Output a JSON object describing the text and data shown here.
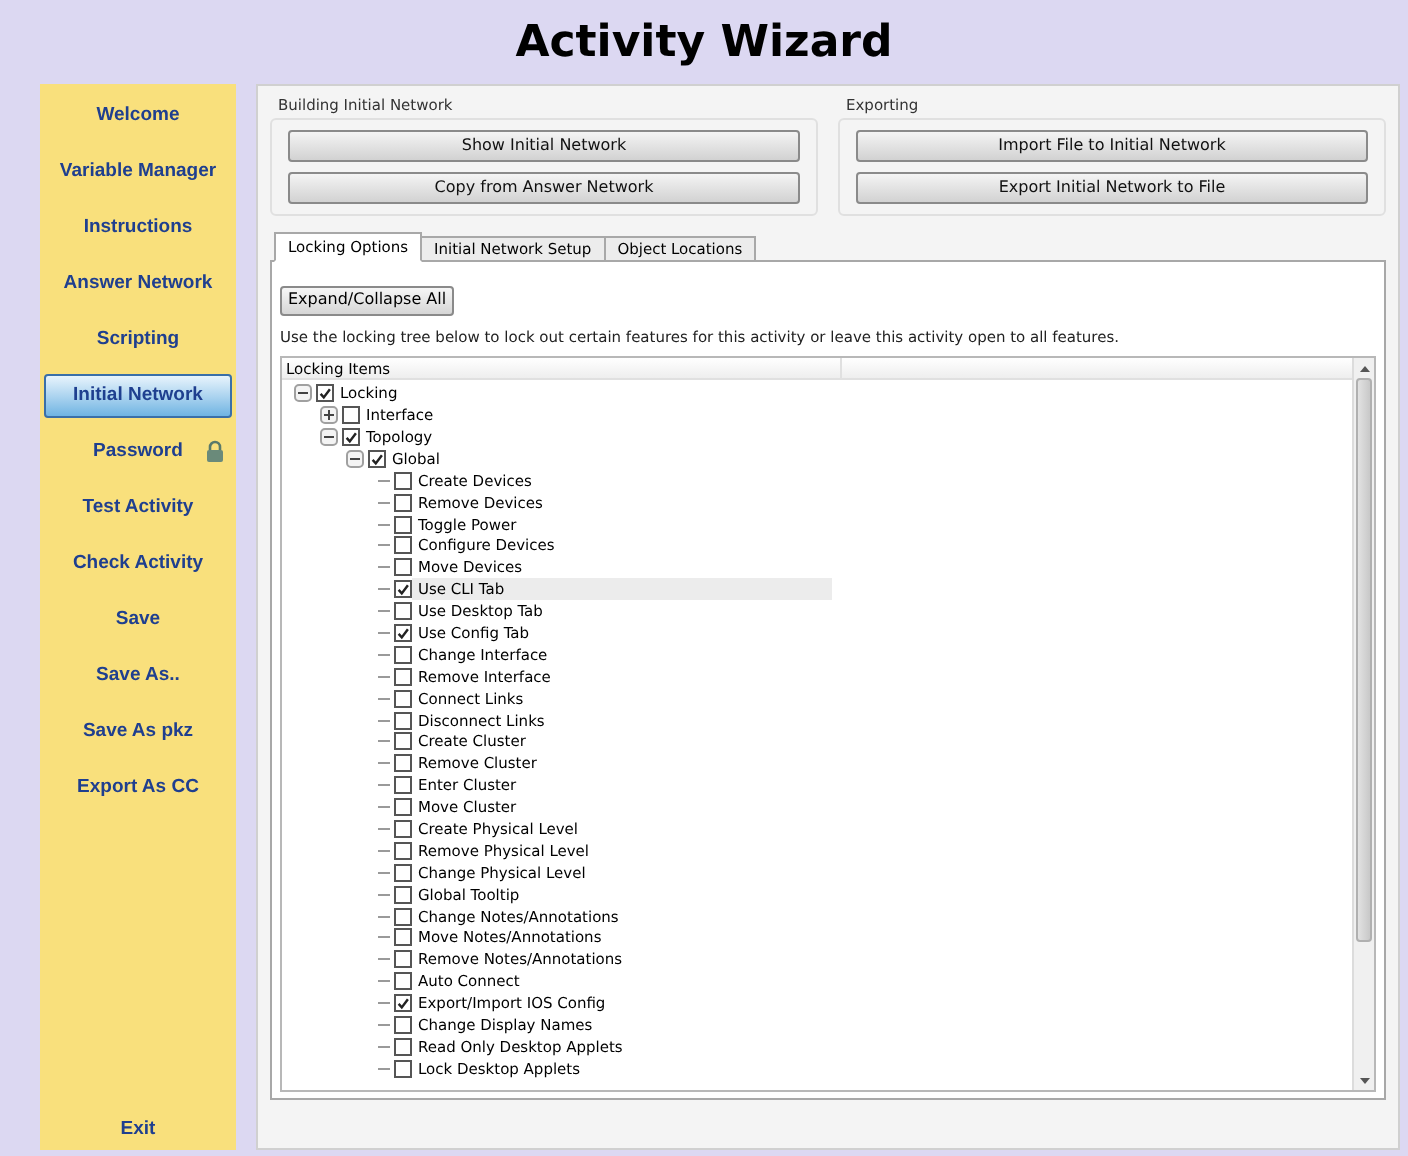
{
  "window": {
    "title": "Activity Wizard"
  },
  "sidebar": {
    "items": [
      {
        "label": "Welcome",
        "selected": false,
        "locked": false
      },
      {
        "label": "Variable Manager",
        "selected": false,
        "locked": false
      },
      {
        "label": "Instructions",
        "selected": false,
        "locked": false
      },
      {
        "label": "Answer Network",
        "selected": false,
        "locked": false
      },
      {
        "label": "Scripting",
        "selected": false,
        "locked": false
      },
      {
        "label": "Initial Network",
        "selected": true,
        "locked": false
      },
      {
        "label": "Password",
        "selected": false,
        "locked": true
      },
      {
        "label": "Test Activity",
        "selected": false,
        "locked": false
      },
      {
        "label": "Check Activity",
        "selected": false,
        "locked": false
      },
      {
        "label": "Save",
        "selected": false,
        "locked": false
      },
      {
        "label": "Save As..",
        "selected": false,
        "locked": false
      },
      {
        "label": "Save As pkz",
        "selected": false,
        "locked": false
      },
      {
        "label": "Export As CC",
        "selected": false,
        "locked": false
      }
    ],
    "exit": "Exit"
  },
  "groups": [
    {
      "title": "Building Initial Network",
      "buttons": [
        "Show Initial Network",
        "Copy from Answer Network"
      ]
    },
    {
      "title": "Exporting",
      "buttons": [
        "Import File to Initial Network",
        "Export Initial Network to File"
      ]
    }
  ],
  "tabs": [
    {
      "label": "Locking Options",
      "selected": true
    },
    {
      "label": "Initial Network Setup",
      "selected": false
    },
    {
      "label": "Object Locations",
      "selected": false
    }
  ],
  "expand_button": "Expand/Collapse All",
  "description": "Use the locking tree below to lock out certain features for this activity or leave this activity open to all features.",
  "tree": {
    "header": "Locking Items",
    "items": [
      {
        "label": "Locking",
        "checked": true,
        "selected": false,
        "expanded": true,
        "children": [
          {
            "label": "Interface",
            "checked": false,
            "selected": false,
            "expanded": false
          },
          {
            "label": "Topology",
            "checked": true,
            "selected": false,
            "expanded": true,
            "children": [
              {
                "label": "Global",
                "checked": true,
                "selected": false,
                "expanded": true,
                "children": [
                  {
                    "label": "Create Devices",
                    "checked": false,
                    "selected": false
                  },
                  {
                    "label": "Remove Devices",
                    "checked": false,
                    "selected": false
                  },
                  {
                    "label": "Toggle Power",
                    "checked": false,
                    "selected": false
                  },
                  {
                    "label": "Configure Devices",
                    "checked": false,
                    "selected": false
                  },
                  {
                    "label": "Move Devices",
                    "checked": false,
                    "selected": false
                  },
                  {
                    "label": "Use CLI Tab",
                    "checked": true,
                    "selected": true
                  },
                  {
                    "label": "Use Desktop Tab",
                    "checked": false,
                    "selected": false
                  },
                  {
                    "label": "Use Config Tab",
                    "checked": true,
                    "selected": false
                  },
                  {
                    "label": "Change Interface",
                    "checked": false,
                    "selected": false
                  },
                  {
                    "label": "Remove Interface",
                    "checked": false,
                    "selected": false
                  },
                  {
                    "label": "Connect Links",
                    "checked": false,
                    "selected": false
                  },
                  {
                    "label": "Disconnect Links",
                    "checked": false,
                    "selected": false
                  },
                  {
                    "label": "Create Cluster",
                    "checked": false,
                    "selected": false
                  },
                  {
                    "label": "Remove Cluster",
                    "checked": false,
                    "selected": false
                  },
                  {
                    "label": "Enter Cluster",
                    "checked": false,
                    "selected": false
                  },
                  {
                    "label": "Move Cluster",
                    "checked": false,
                    "selected": false
                  },
                  {
                    "label": "Create Physical Level",
                    "checked": false,
                    "selected": false
                  },
                  {
                    "label": "Remove Physical Level",
                    "checked": false,
                    "selected": false
                  },
                  {
                    "label": "Change Physical Level",
                    "checked": false,
                    "selected": false
                  },
                  {
                    "label": "Global Tooltip",
                    "checked": false,
                    "selected": false
                  },
                  {
                    "label": "Change Notes/Annotations",
                    "checked": false,
                    "selected": false
                  },
                  {
                    "label": "Move Notes/Annotations",
                    "checked": false,
                    "selected": false
                  },
                  {
                    "label": "Remove Notes/Annotations",
                    "checked": false,
                    "selected": false
                  },
                  {
                    "label": "Auto Connect",
                    "checked": false,
                    "selected": false
                  },
                  {
                    "label": "Export/Import IOS Config",
                    "checked": true,
                    "selected": false
                  },
                  {
                    "label": "Change Display Names",
                    "checked": false,
                    "selected": false
                  },
                  {
                    "label": "Read Only Desktop Applets",
                    "checked": false,
                    "selected": false
                  },
                  {
                    "label": "Lock Desktop Applets",
                    "checked": false,
                    "selected": false
                  }
                ]
              }
            ]
          }
        ]
      }
    ]
  }
}
